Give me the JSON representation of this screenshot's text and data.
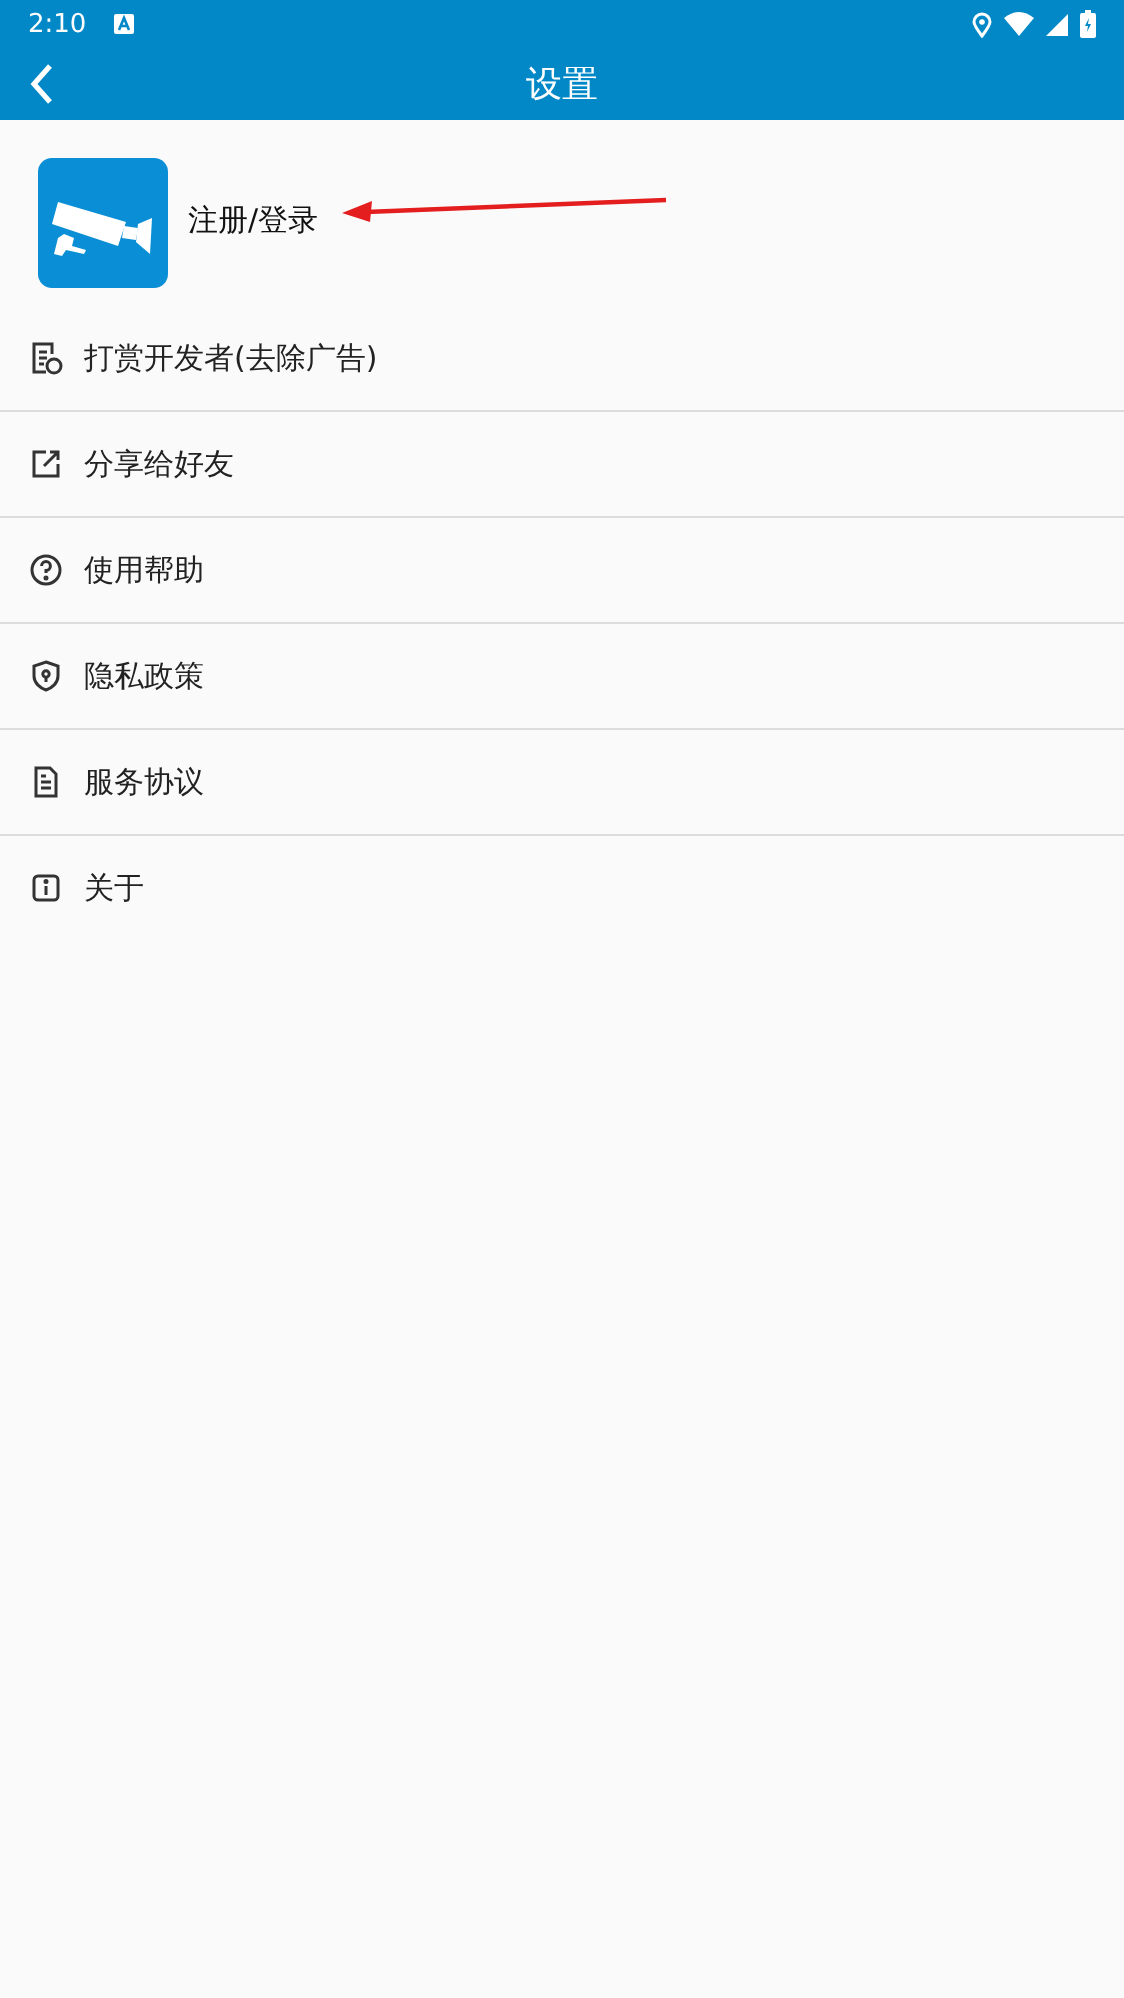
{
  "status_bar": {
    "time": "2:10"
  },
  "toolbar": {
    "title": "设置"
  },
  "account": {
    "label": "注册/登录"
  },
  "menu": [
    {
      "kind": "reward",
      "label": "打赏开发者(去除广告)"
    },
    {
      "kind": "share",
      "label": "分享给好友"
    },
    {
      "kind": "help",
      "label": "使用帮助"
    },
    {
      "kind": "privacy",
      "label": "隐私政策"
    },
    {
      "kind": "terms",
      "label": "服务协议"
    },
    {
      "kind": "about",
      "label": "关于"
    }
  ]
}
